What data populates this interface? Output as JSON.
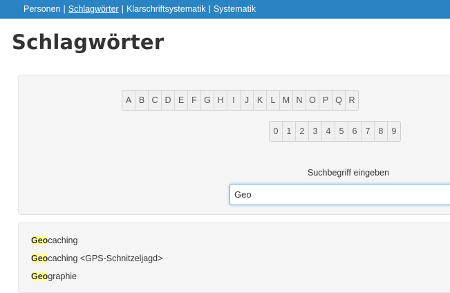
{
  "nav": {
    "items": [
      {
        "label": "Personen"
      },
      {
        "label": "Schlagwörter",
        "active": true
      },
      {
        "label": "Klarschriftsystematik"
      },
      {
        "label": "Systematik"
      }
    ],
    "separator": "|"
  },
  "page_title": "Schlagwörter",
  "letters": [
    "A",
    "B",
    "C",
    "D",
    "E",
    "F",
    "G",
    "H",
    "I",
    "J",
    "K",
    "L",
    "M",
    "N",
    "O",
    "P",
    "Q",
    "R"
  ],
  "digits": [
    "0",
    "1",
    "2",
    "3",
    "4",
    "5",
    "6",
    "7",
    "8",
    "9"
  ],
  "search": {
    "label": "Suchbegriff eingeben",
    "value": "Geo"
  },
  "results": [
    {
      "match": "Geo",
      "rest": "caching"
    },
    {
      "match": "Geo",
      "rest": "caching <GPS-Schnitzeljagd>"
    },
    {
      "match": "Geo",
      "rest": "graphie"
    }
  ],
  "colors": {
    "nav_background": "#2a84c4",
    "highlight": "#ffff99"
  }
}
